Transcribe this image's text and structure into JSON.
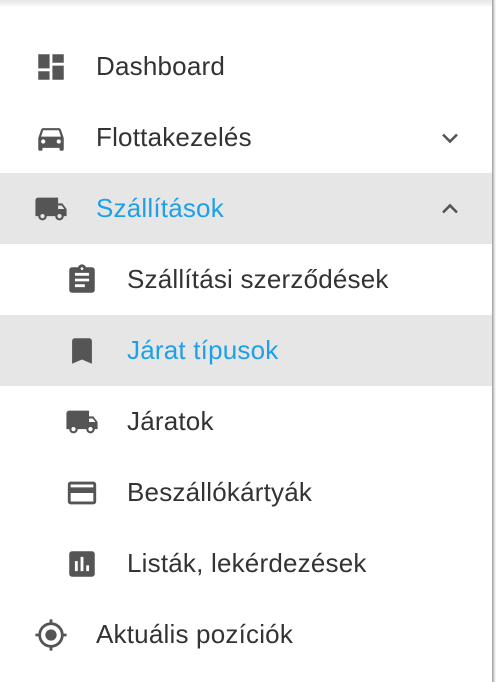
{
  "colors": {
    "accent": "#1ea0e8",
    "text": "#333333",
    "icon": "#555555",
    "active_bg": "#e6e6e6"
  },
  "menu": {
    "dashboard": {
      "label": "Dashboard",
      "icon": "dashboard-icon"
    },
    "flotta": {
      "label": "Flottakezelés",
      "icon": "car-icon",
      "expanded": false
    },
    "szallitasok": {
      "label": "Szállítások",
      "icon": "truck-icon",
      "expanded": true,
      "active": true,
      "children": [
        {
          "label": "Szállítási szerződések",
          "icon": "clipboard-icon"
        },
        {
          "label": "Járat típusok",
          "icon": "bookmark-icon",
          "active": true
        },
        {
          "label": "Járatok",
          "icon": "truck-icon"
        },
        {
          "label": "Beszállókártyák",
          "icon": "card-icon"
        },
        {
          "label": "Listák, lekérdezések",
          "icon": "chart-icon"
        }
      ]
    },
    "aktualis": {
      "label": "Aktuális pozíciók",
      "icon": "location-icon"
    }
  }
}
